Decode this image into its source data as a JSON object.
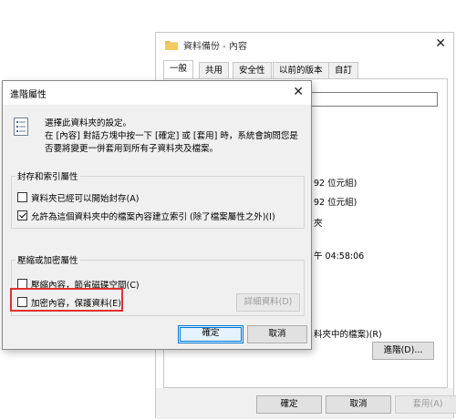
{
  "bg_window": {
    "title": "資料備份 - 內容",
    "close_glyph": "✕",
    "tabs": [
      "一般",
      "共用",
      "安全性",
      "以前的版本",
      "自訂"
    ],
    "active_tab": "一般",
    "partial_texts": {
      "size": "92 位元組)",
      "size_on_disk": "92 位元組)",
      "contains": "夾",
      "created": "午 04:58:06",
      "attributes": "料夾中的檔案)(R)"
    },
    "advanced_button": "進階(D)...",
    "ok": "確定",
    "cancel": "取消",
    "apply": "套用(A)"
  },
  "dialog": {
    "title": "進階屬性",
    "close_glyph": "✕",
    "desc1": "選擇此資料夾的設定。",
    "desc2": "在 [內容] 對話方塊中按一下 [確定] 或 [套用] 時，系統會詢問您是否要將變更一併套用到所有子資料夾及檔案。",
    "archive_group": {
      "title": "封存和索引屬性",
      "archive_label": "資料夾已經可以開始封存(A)",
      "archive_checked": false,
      "index_label": "允許為這個資料夾中的檔案內容建立索引 (除了檔案屬性之外)(I)",
      "index_checked": true
    },
    "compress_group": {
      "title": "壓縮或加密屬性",
      "compress_label": "壓縮內容，節省磁碟空間(C)",
      "compress_checked": false,
      "encrypt_label": "加密內容，保護資料(E)",
      "encrypt_checked": false,
      "details_button": "詳細資料(D)"
    },
    "ok": "確定",
    "cancel": "取消"
  },
  "colors": {
    "highlight": "#e0322d",
    "accent": "#0078d7"
  }
}
